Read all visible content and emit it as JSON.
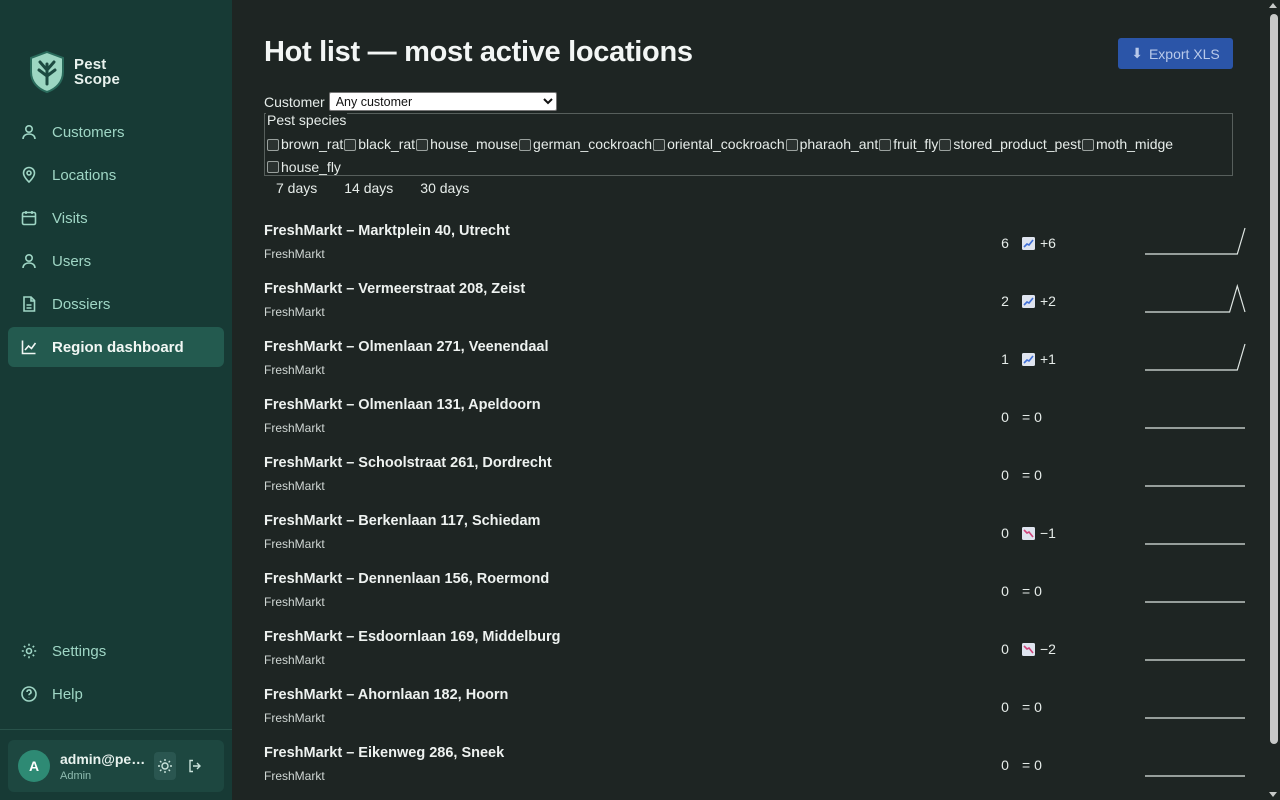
{
  "brand": {
    "line1": "Pest",
    "line2": "Scope"
  },
  "nav": {
    "items": [
      {
        "label": "Customers",
        "icon": "user-icon"
      },
      {
        "label": "Locations",
        "icon": "map-pin-icon"
      },
      {
        "label": "Visits",
        "icon": "calendar-icon"
      },
      {
        "label": "Users",
        "icon": "user-icon"
      },
      {
        "label": "Dossiers",
        "icon": "file-icon"
      },
      {
        "label": "Region dashboard",
        "icon": "chart-line-icon",
        "active": true
      }
    ],
    "bottom": [
      {
        "label": "Settings",
        "icon": "gear-icon"
      },
      {
        "label": "Help",
        "icon": "help-circle-icon"
      }
    ]
  },
  "user": {
    "initial": "A",
    "email": "admin@pes...",
    "role": "Admin"
  },
  "page": {
    "title": "Hot list — most active locations",
    "export_label": "Export XLS"
  },
  "filters": {
    "customer_label": "Customer",
    "customer_selected": "Any customer",
    "species_legend": "Pest species",
    "species": [
      "brown_rat",
      "black_rat",
      "house_mouse",
      "german_cockroach",
      "oriental_cockroach",
      "pharaoh_ant",
      "fruit_fly",
      "stored_product_pest",
      "moth_midge",
      "house_fly"
    ],
    "ranges": [
      "7 days",
      "14 days",
      "30 days"
    ]
  },
  "locations": [
    {
      "name": "FreshMarkt – Marktplein 40, Utrecht",
      "customer": "FreshMarkt",
      "count": "6",
      "trend": "+6",
      "direction": "up",
      "spark": [
        0,
        0,
        0,
        0,
        0,
        0,
        0,
        0,
        0,
        0,
        0,
        0,
        0,
        6
      ]
    },
    {
      "name": "FreshMarkt – Vermeerstraat 208, Zeist",
      "customer": "FreshMarkt",
      "count": "2",
      "trend": "+2",
      "direction": "up",
      "spark": [
        0,
        0,
        0,
        0,
        0,
        0,
        0,
        0,
        0,
        0,
        0,
        0,
        2,
        0
      ]
    },
    {
      "name": "FreshMarkt – Olmenlaan 271, Veenendaal",
      "customer": "FreshMarkt",
      "count": "1",
      "trend": "+1",
      "direction": "up",
      "spark": [
        0,
        0,
        0,
        0,
        0,
        0,
        0,
        0,
        0,
        0,
        0,
        0,
        0,
        1
      ]
    },
    {
      "name": "FreshMarkt – Olmenlaan 131, Apeldoorn",
      "customer": "FreshMarkt",
      "count": "0",
      "trend": "= 0",
      "direction": "flat",
      "spark": [
        0,
        0,
        0,
        0,
        0,
        0,
        0,
        0,
        0,
        0,
        0,
        0,
        0,
        0
      ]
    },
    {
      "name": "FreshMarkt – Schoolstraat 261, Dordrecht",
      "customer": "FreshMarkt",
      "count": "0",
      "trend": "= 0",
      "direction": "flat",
      "spark": [
        0,
        0,
        0,
        0,
        0,
        0,
        0,
        0,
        0,
        0,
        0,
        0,
        0,
        0
      ]
    },
    {
      "name": "FreshMarkt – Berkenlaan 117, Schiedam",
      "customer": "FreshMarkt",
      "count": "0",
      "trend": "−1",
      "direction": "down",
      "spark": [
        0,
        0,
        0,
        0,
        0,
        0,
        0,
        0,
        0,
        0,
        0,
        0,
        0,
        0
      ]
    },
    {
      "name": "FreshMarkt – Dennenlaan 156, Roermond",
      "customer": "FreshMarkt",
      "count": "0",
      "trend": "= 0",
      "direction": "flat",
      "spark": [
        0,
        0,
        0,
        0,
        0,
        0,
        0,
        0,
        0,
        0,
        0,
        0,
        0,
        0
      ]
    },
    {
      "name": "FreshMarkt – Esdoornlaan 169, Middelburg",
      "customer": "FreshMarkt",
      "count": "0",
      "trend": "−2",
      "direction": "down",
      "spark": [
        0,
        0,
        0,
        0,
        0,
        0,
        0,
        0,
        0,
        0,
        0,
        0,
        0,
        0
      ]
    },
    {
      "name": "FreshMarkt – Ahornlaan 182, Hoorn",
      "customer": "FreshMarkt",
      "count": "0",
      "trend": "= 0",
      "direction": "flat",
      "spark": [
        0,
        0,
        0,
        0,
        0,
        0,
        0,
        0,
        0,
        0,
        0,
        0,
        0,
        0
      ]
    },
    {
      "name": "FreshMarkt – Eikenweg 286, Sneek",
      "customer": "FreshMarkt",
      "count": "0",
      "trend": "= 0",
      "direction": "flat",
      "spark": [
        0,
        0,
        0,
        0,
        0,
        0,
        0,
        0,
        0,
        0,
        0,
        0,
        0,
        0
      ]
    }
  ],
  "colors": {
    "sidebar": "#173a35",
    "accent": "#235a4f",
    "export": "#2b55a8",
    "trend_up": "#3f6fd8",
    "trend_down": "#d0457a"
  }
}
